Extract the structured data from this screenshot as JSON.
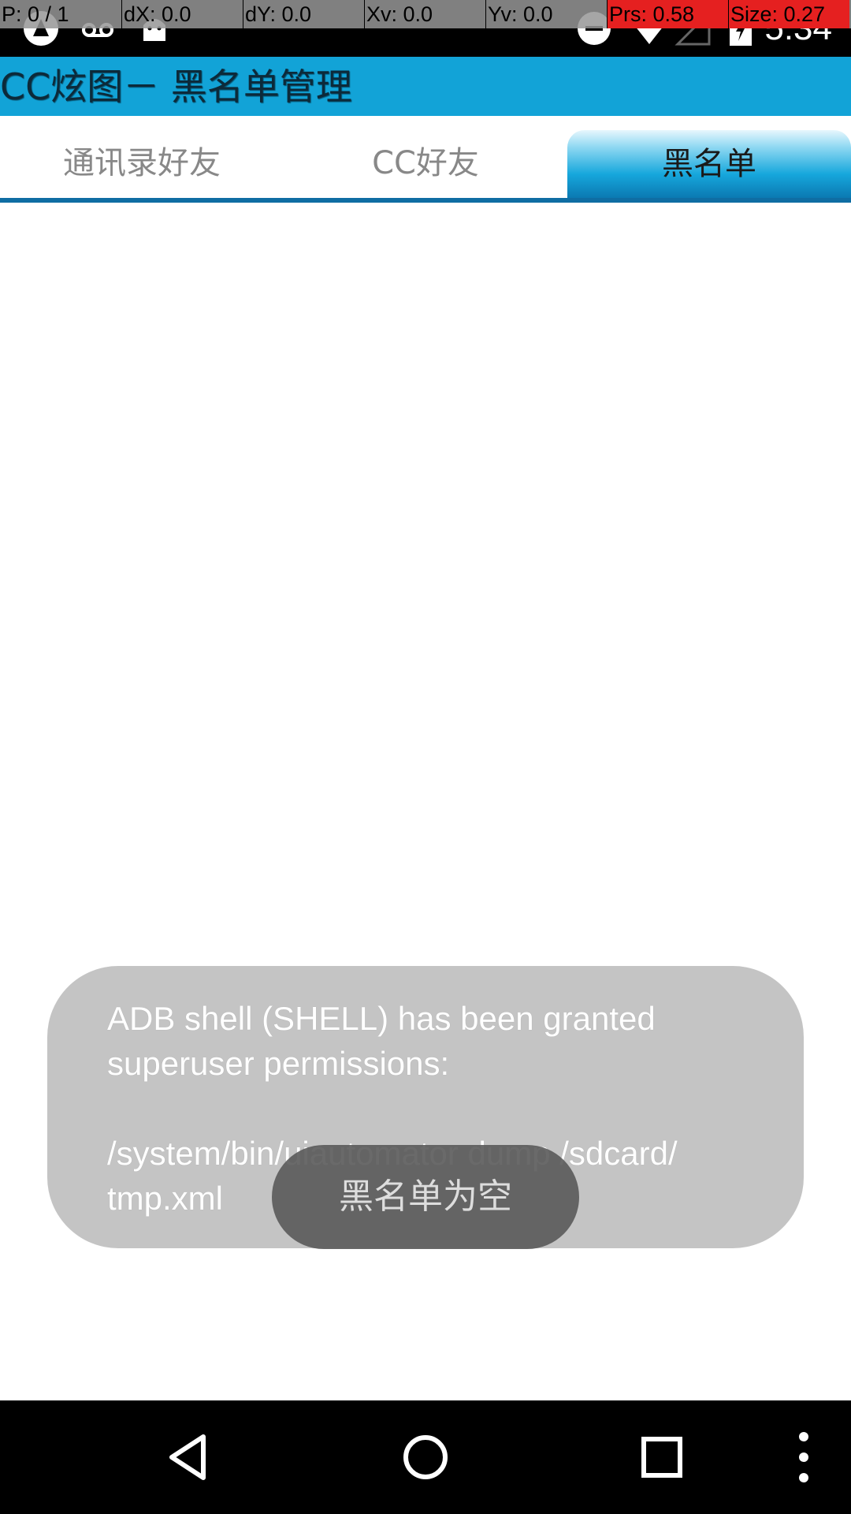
{
  "status_bar": {
    "time": "5:34",
    "icons": [
      "notification-app-icon",
      "voicemail-icon",
      "android-icon",
      "do-not-disturb-icon",
      "wifi-icon",
      "cell-signal-icon",
      "battery-charging-icon"
    ]
  },
  "debug_overlay": {
    "cells": [
      "P: 0 / 1",
      "dX: 0.0",
      "dY: 0.0",
      "Xv: 0.0",
      "Yv: 0.0",
      "Prs: 0.58",
      "Size: 0.27"
    ]
  },
  "app_bar": {
    "title": "CC炫图－ 黑名单管理"
  },
  "tabs": [
    {
      "label": "通讯录好友",
      "active": false
    },
    {
      "label": "CC好友",
      "active": false
    },
    {
      "label": "黑名单",
      "active": true
    }
  ],
  "su_toast": {
    "line1": "ADB shell (SHELL) has been granted",
    "line2": "superuser permissions:",
    "line3": "",
    "line4": "/system/bin/uiautomator dump /sdcard/",
    "line5": "tmp.xml"
  },
  "empty_toast": {
    "text": "黑名单为空"
  },
  "nav_bar": {
    "buttons": [
      "back-icon",
      "home-icon",
      "recents-icon",
      "overflow-menu-icon"
    ]
  },
  "colors": {
    "app_bar": "#12a3d7",
    "tab_indicator": "#0f6da3",
    "debug_alert": "#e52020"
  }
}
